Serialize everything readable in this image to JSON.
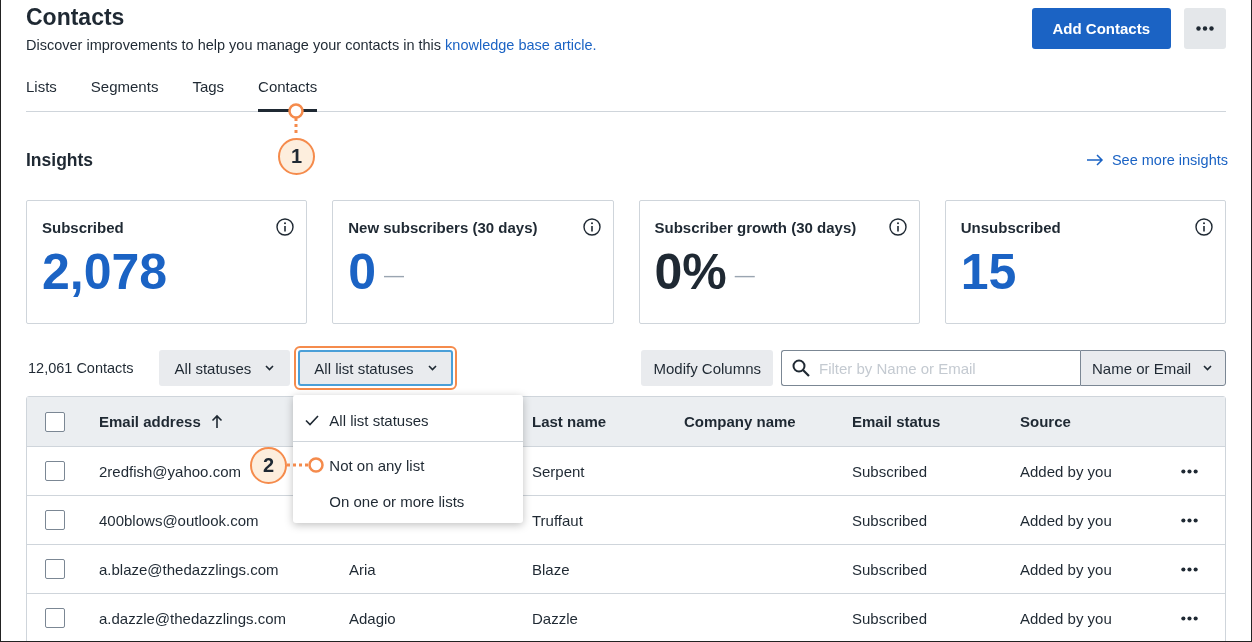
{
  "header": {
    "title": "Contacts",
    "description": "Discover improvements to help you manage your contacts in this ",
    "link": "knowledge base article.",
    "primary_button": "Add Contacts"
  },
  "tabs": [
    {
      "label": "Lists",
      "selected": false
    },
    {
      "label": "Segments",
      "selected": false
    },
    {
      "label": "Tags",
      "selected": false
    },
    {
      "label": "Contacts",
      "selected": true
    }
  ],
  "insights": {
    "title": "Insights",
    "link": "See more insights",
    "cards": [
      {
        "label": "Subscribed",
        "value": "2,078",
        "color": "#1b63c4"
      },
      {
        "label": "New subscribers (30 days)",
        "value": "0",
        "color": "#1b63c4",
        "trend": "—"
      },
      {
        "label": "Subscriber growth (30 days)",
        "value": "0%",
        "color": "#1f2933",
        "trend": "—"
      },
      {
        "label": "Unsubscribed",
        "value": "15",
        "color": "#1b63c4"
      }
    ]
  },
  "toolbar": {
    "count": "12,061 Contacts",
    "filters": [
      {
        "label": "All statuses",
        "open": false
      },
      {
        "label": "All list statuses",
        "open": true
      }
    ],
    "modify_button": "Modify Columns",
    "search": {
      "placeholder": "Filter by Name or Email",
      "scope": "Name or Email"
    }
  },
  "dropdown": {
    "options": [
      {
        "label": "All list statuses",
        "selected": true
      },
      {
        "label": "Not on any list",
        "selected": false
      },
      {
        "label": "On one or more lists",
        "selected": false
      }
    ]
  },
  "table": {
    "select_all_checked": false,
    "sort_ascending": true,
    "columns": {
      "email": "Email address",
      "last_name": "Last name",
      "company": "Company name",
      "email_status": "Email status",
      "source": "Source"
    },
    "rows": [
      {
        "checked": false,
        "email": "2redfish@yahoo.com",
        "last_name": "Serpent",
        "email_status": "Subscribed",
        "source": "Added by you"
      },
      {
        "checked": false,
        "email": "400blows@outlook.com",
        "last_name": "Truffaut",
        "email_status": "Subscribed",
        "source": "Added by you"
      },
      {
        "checked": false,
        "email": "a.blaze@thedazzlings.com",
        "first_name": "Aria",
        "last_name": "Blaze",
        "email_status": "Subscribed",
        "source": "Added by you"
      },
      {
        "checked": false,
        "email": "a.dazzle@thedazzlings.com",
        "first_name": "Adagio",
        "last_name": "Dazzle",
        "email_status": "Subscribed",
        "source": "Added by you"
      }
    ]
  },
  "annotations": [
    {
      "number": "1"
    },
    {
      "number": "2"
    }
  ]
}
